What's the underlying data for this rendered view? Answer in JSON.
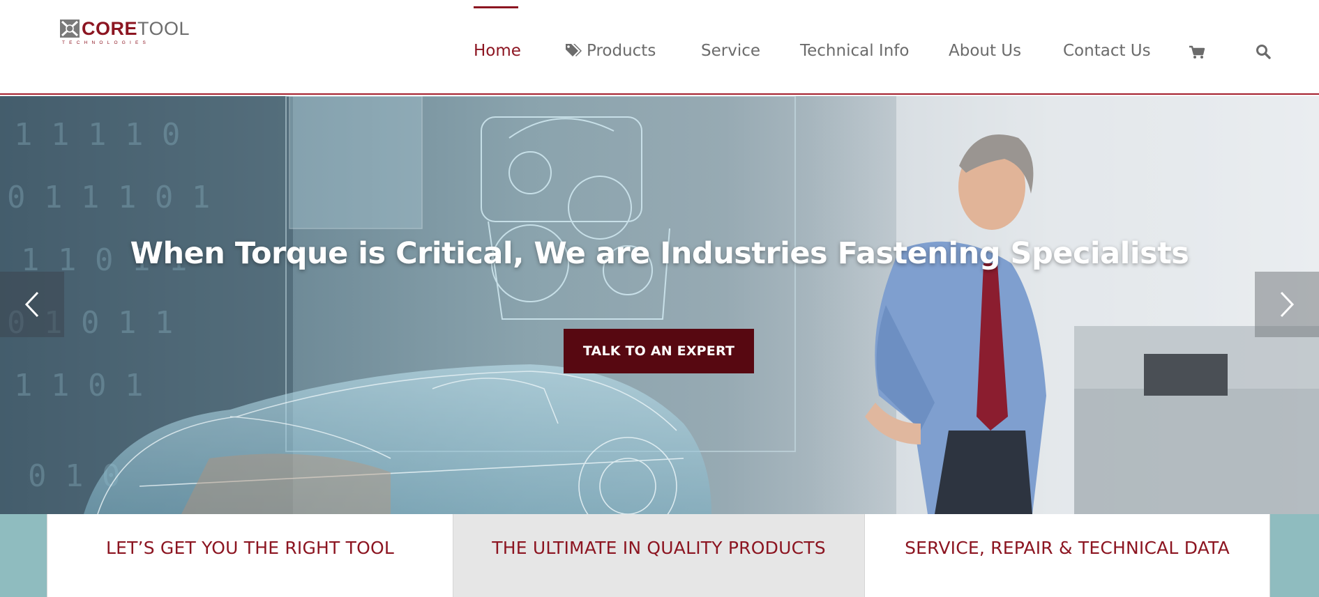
{
  "brand": {
    "name_part1": "CORE",
    "name_part2": "TOOL",
    "tagline": "TECHNOLOGIES",
    "accent_color": "#8c1521"
  },
  "nav": {
    "items": [
      {
        "label": "Home",
        "active": true
      },
      {
        "label": "Products",
        "icon": "tags-icon"
      },
      {
        "label": "Service"
      },
      {
        "label": "Technical Info"
      },
      {
        "label": "About Us"
      },
      {
        "label": "Contact Us"
      }
    ],
    "cart_icon": "cart-icon",
    "search_icon": "search-icon"
  },
  "hero": {
    "headline": "When Torque is Critical, We are Industries Fastening Specialists",
    "cta_label": "TALK TO AN EXPERT",
    "cta_color": "#570811",
    "prev_icon": "chevron-left-icon",
    "next_icon": "chevron-right-icon"
  },
  "features": [
    {
      "label": "LET’S GET YOU THE RIGHT TOOL"
    },
    {
      "label": "THE ULTIMATE IN QUALITY PRODUCTS"
    },
    {
      "label": "SERVICE, REPAIR & TECHNICAL DATA"
    }
  ]
}
